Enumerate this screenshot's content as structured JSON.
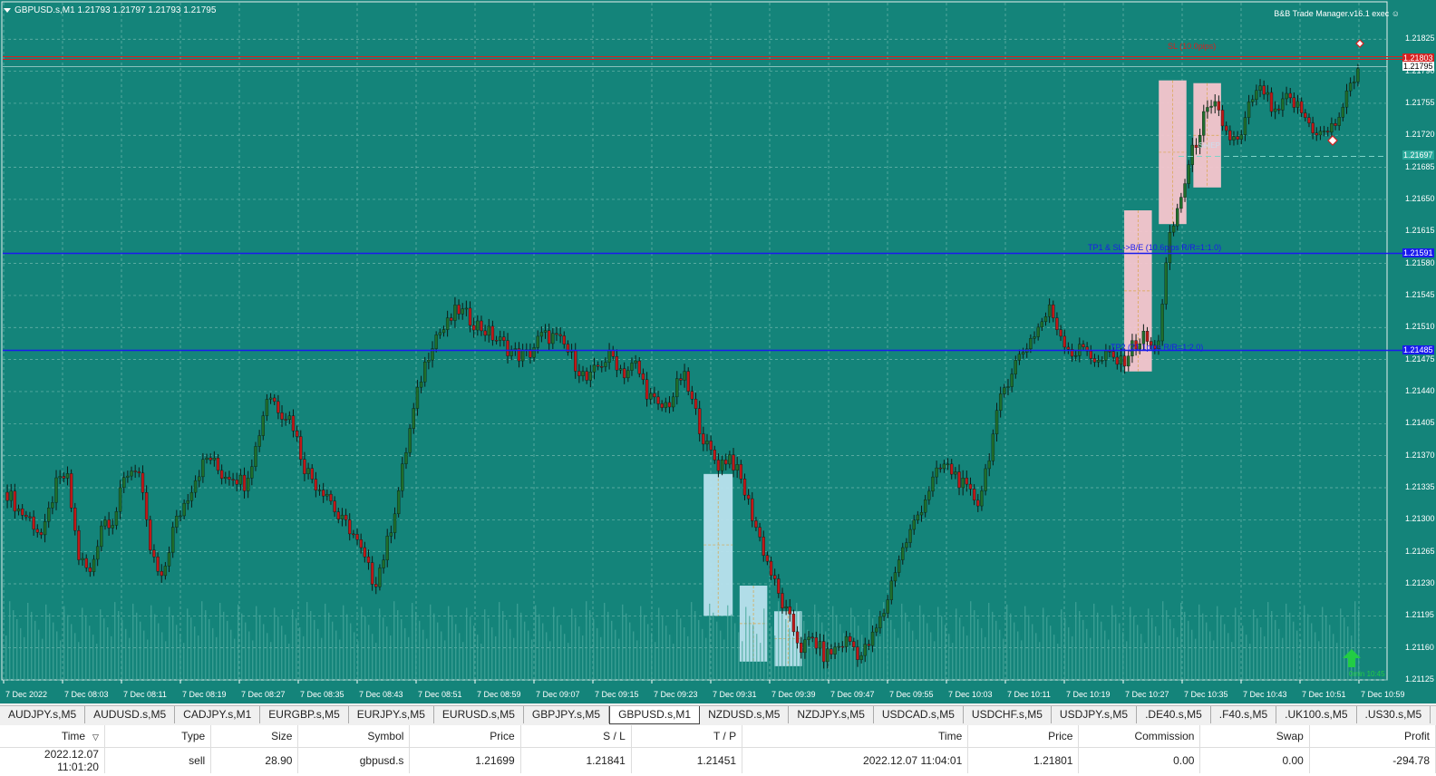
{
  "header": {
    "symbol_info": "GBPUSD.s,M1  1.21793 1.21797 1.21793 1.21795",
    "ea_name": "B&B Trade Manager.v16.1 exec ☺"
  },
  "chart_data": {
    "type": "candlestick",
    "ylim": [
      1.21125,
      1.2185
    ],
    "y_ticks": [
      "1.21825",
      "1.21790",
      "1.21755",
      "1.21720",
      "1.21685",
      "1.21650",
      "1.21615",
      "1.21580",
      "1.21545",
      "1.21510",
      "1.21475",
      "1.21440",
      "1.21405",
      "1.21370",
      "1.21335",
      "1.21300",
      "1.21265",
      "1.21230",
      "1.21195",
      "1.21160",
      "1.21125"
    ],
    "x_ticks": [
      "7 Dec 2022",
      "7 Dec 08:03",
      "7 Dec 08:11",
      "7 Dec 08:19",
      "7 Dec 08:27",
      "7 Dec 08:35",
      "7 Dec 08:43",
      "7 Dec 08:51",
      "7 Dec 08:59",
      "7 Dec 09:07",
      "7 Dec 09:15",
      "7 Dec 09:23",
      "7 Dec 09:31",
      "7 Dec 09:39",
      "7 Dec 09:47",
      "7 Dec 09:55",
      "7 Dec 10:03",
      "7 Dec 10:11",
      "7 Dec 10:19",
      "7 Dec 10:27",
      "7 Dec 10:35",
      "7 Dec 10:43",
      "7 Dec 10:51",
      "7 Dec 10:59"
    ],
    "close_path": [
      1.2133,
      1.2131,
      1.213,
      1.2128,
      1.21335,
      1.2135,
      1.2126,
      1.2124,
      1.213,
      1.213,
      1.2135,
      1.2136,
      1.2127,
      1.2123,
      1.2129,
      1.2132,
      1.2135,
      1.2137,
      1.2135,
      1.2135,
      1.2134,
      1.2138,
      1.2144,
      1.2142,
      1.2141,
      1.2136,
      1.2134,
      1.2133,
      1.213,
      1.2129,
      1.2126,
      1.2123,
      1.2127,
      1.2133,
      1.214,
      1.2146,
      1.215,
      1.2151,
      1.2153,
      1.2152,
      1.2151,
      1.215,
      1.2149,
      1.2148,
      1.2148,
      1.215,
      1.215,
      1.2149,
      1.2147,
      1.2145,
      1.2147,
      1.2148,
      1.2146,
      1.2147,
      1.2144,
      1.2142,
      1.2143,
      1.2146,
      1.2142,
      1.2138,
      1.2136,
      1.2137,
      1.2134,
      1.213,
      1.2126,
      1.2122,
      1.2119,
      1.2116,
      1.2117,
      1.2115,
      1.2116,
      1.2117,
      1.2115,
      1.2117,
      1.212,
      1.2125,
      1.2128,
      1.2131,
      1.2134,
      1.2136,
      1.2135,
      1.2133,
      1.2132,
      1.2138,
      1.2144,
      1.2147,
      1.2149,
      1.2151,
      1.2153,
      1.215,
      1.2148,
      1.2149,
      1.2147,
      1.2148,
      1.2147,
      1.2149,
      1.215,
      1.2148,
      1.216,
      1.2165,
      1.217,
      1.2174,
      1.2175,
      1.2172,
      1.2171,
      1.2176,
      1.2177,
      1.2174,
      1.2176,
      1.2175,
      1.2173,
      1.2172,
      1.2173,
      1.2176,
      1.21795
    ],
    "levels": [
      {
        "name": "SL",
        "price": 1.21803,
        "color": "#d62020",
        "label": "SL (10.0pips)",
        "tag": "1.21803"
      },
      {
        "name": "TP1",
        "price": 1.21591,
        "color": "#1a1aee",
        "label": "TP1 & SL->B/E (10.6pips R/R=1:1.0)",
        "tag": "1.21591"
      },
      {
        "name": "TP2",
        "price": 1.21485,
        "color": "#1a1aee",
        "label": "TP2 (21.1pips R/R=1:2.0)",
        "tag": "1.21485"
      },
      {
        "name": "Entry",
        "price": 1.21697,
        "color": "#2aa89a",
        "label": "SellEP",
        "tag": "1.21697"
      },
      {
        "name": "Current",
        "price": 1.21795,
        "color": "#ffffff",
        "label": "",
        "tag": "1.21795"
      }
    ],
    "zones": [
      {
        "kind": "bearish-fvg",
        "x0": 0.506,
        "x1": 0.527,
        "p0": 1.2135,
        "p1": 1.21195,
        "color": "#b9e2ee"
      },
      {
        "kind": "bearish-fvg",
        "x0": 0.532,
        "x1": 0.552,
        "p0": 1.21228,
        "p1": 1.21145,
        "color": "#b9e2ee"
      },
      {
        "kind": "bearish-fvg",
        "x0": 0.557,
        "x1": 0.577,
        "p0": 1.212,
        "p1": 1.2114,
        "color": "#b9e2ee"
      },
      {
        "kind": "bullish-fvg",
        "x0": 0.81,
        "x1": 0.83,
        "p0": 1.21638,
        "p1": 1.21462,
        "color": "#f7c5cd"
      },
      {
        "kind": "bullish-fvg",
        "x0": 0.835,
        "x1": 0.855,
        "p0": 1.2178,
        "p1": 1.21623,
        "color": "#f7c5cd"
      },
      {
        "kind": "bullish-fvg",
        "x0": 0.86,
        "x1": 0.88,
        "p0": 1.21777,
        "p1": 1.21663,
        "color": "#f7c5cd"
      }
    ],
    "bull_color": "#1f6e2c",
    "bear_color": "#c01818",
    "timer_label": "0min 10:45"
  },
  "tabs": [
    "AUDJPY.s,M5",
    "AUDUSD.s,M5",
    "CADJPY.s,M1",
    "EURGBP.s,M5",
    "EURJPY.s,M5",
    "EURUSD.s,M5",
    "GBPJPY.s,M5",
    "GBPUSD.s,M1",
    "NZDUSD.s,M5",
    "NZDJPY.s,M5",
    "USDCAD.s,M5",
    "USDCHF.s,M5",
    "USDJPY.s,M5",
    ".DE40.s,M5",
    ".F40.s,M5",
    ".UK100.s,M5",
    ".US30.s,M5",
    ".U"
  ],
  "active_tab": "GBPUSD.s,M1",
  "trade_table": {
    "columns": [
      "Time",
      "Type",
      "Size",
      "Symbol",
      "Price",
      "S / L",
      "T / P",
      "Time",
      "Price",
      "Commission",
      "Swap",
      "Profit"
    ],
    "sort_indicator": "▽",
    "rows": [
      [
        "2022.12.07 11:01:20",
        "sell",
        "28.90",
        "gbpusd.s",
        "1.21699",
        "1.21841",
        "1.21451",
        "2022.12.07 11:04:01",
        "1.21801",
        "0.00",
        "0.00",
        "-294.78"
      ]
    ]
  }
}
